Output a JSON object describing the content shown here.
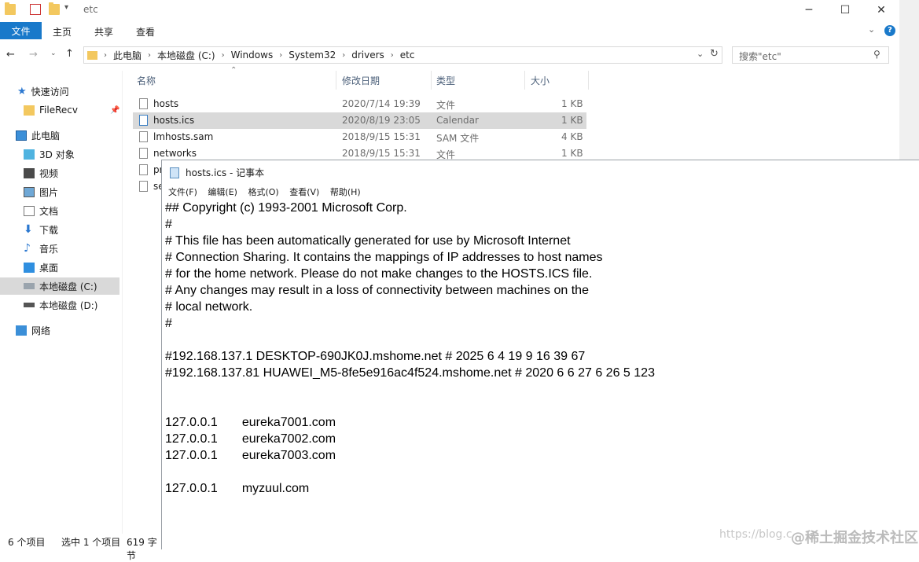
{
  "explorer": {
    "window_title": "etc",
    "ribbon_tabs": [
      "文件",
      "主页",
      "共享",
      "查看"
    ],
    "address_crumbs": [
      "此电脑",
      "本地磁盘 (C:)",
      "Windows",
      "System32",
      "drivers",
      "etc"
    ],
    "search_placeholder": "搜索\"etc\"",
    "nav": {
      "quick_access": "快速访问",
      "filerecv": "FileRecv",
      "this_pc": "此电脑",
      "objects3d": "3D 对象",
      "videos": "视频",
      "pictures": "图片",
      "documents": "文档",
      "downloads": "下载",
      "music": "音乐",
      "desktop": "桌面",
      "drive_c": "本地磁盘 (C:)",
      "drive_d": "本地磁盘 (D:)",
      "network": "网络"
    },
    "columns": {
      "name": "名称",
      "modified": "修改日期",
      "type": "类型",
      "size": "大小"
    },
    "files": [
      {
        "name": "hosts",
        "modified": "2020/7/14 19:39",
        "type": "文件",
        "size": "1 KB"
      },
      {
        "name": "hosts.ics",
        "modified": "2020/8/19 23:05",
        "type": "Calendar",
        "size": "1 KB"
      },
      {
        "name": "lmhosts.sam",
        "modified": "2018/9/15 15:31",
        "type": "SAM 文件",
        "size": "4 KB"
      },
      {
        "name": "networks",
        "modified": "2018/9/15 15:31",
        "type": "文件",
        "size": "1 KB"
      },
      {
        "name": "pr",
        "modified": "",
        "type": "",
        "size": ""
      },
      {
        "name": "se",
        "modified": "",
        "type": "",
        "size": ""
      }
    ],
    "status": {
      "count": "6 个项目",
      "selected": "选中 1 个项目",
      "size": "619 字节"
    }
  },
  "notepad": {
    "title": "hosts.ics - 记事本",
    "menu": [
      "文件(F)",
      "编辑(E)",
      "格式(O)",
      "查看(V)",
      "帮助(H)"
    ],
    "content": "## Copyright (c) 1993-2001 Microsoft Corp.\n#\n# This file has been automatically generated for use by Microsoft Internet\n# Connection Sharing. It contains the mappings of IP addresses to host names\n# for the home network. Please do not make changes to the HOSTS.ICS file.\n# Any changes may result in a loss of connectivity between machines on the\n# local network.\n#\n\n#192.168.137.1 DESKTOP-690JK0J.mshome.net # 2025 6 4 19 9 16 39 67\n#192.168.137.81 HUAWEI_M5-8fe5e916ac4f524.mshome.net # 2020 6 6 27 6 26 5 123\n\n\n127.0.0.1       eureka7001.com\n127.0.0.1       eureka7002.com\n127.0.0.1       eureka7003.com\n\n127.0.0.1       myzuul.com"
  },
  "watermark": {
    "url": "https://blog.c",
    "site": "@稀土掘金技术社区"
  },
  "colors": {
    "accent": "#1979ca",
    "selected_row": "#d9d9d9"
  }
}
